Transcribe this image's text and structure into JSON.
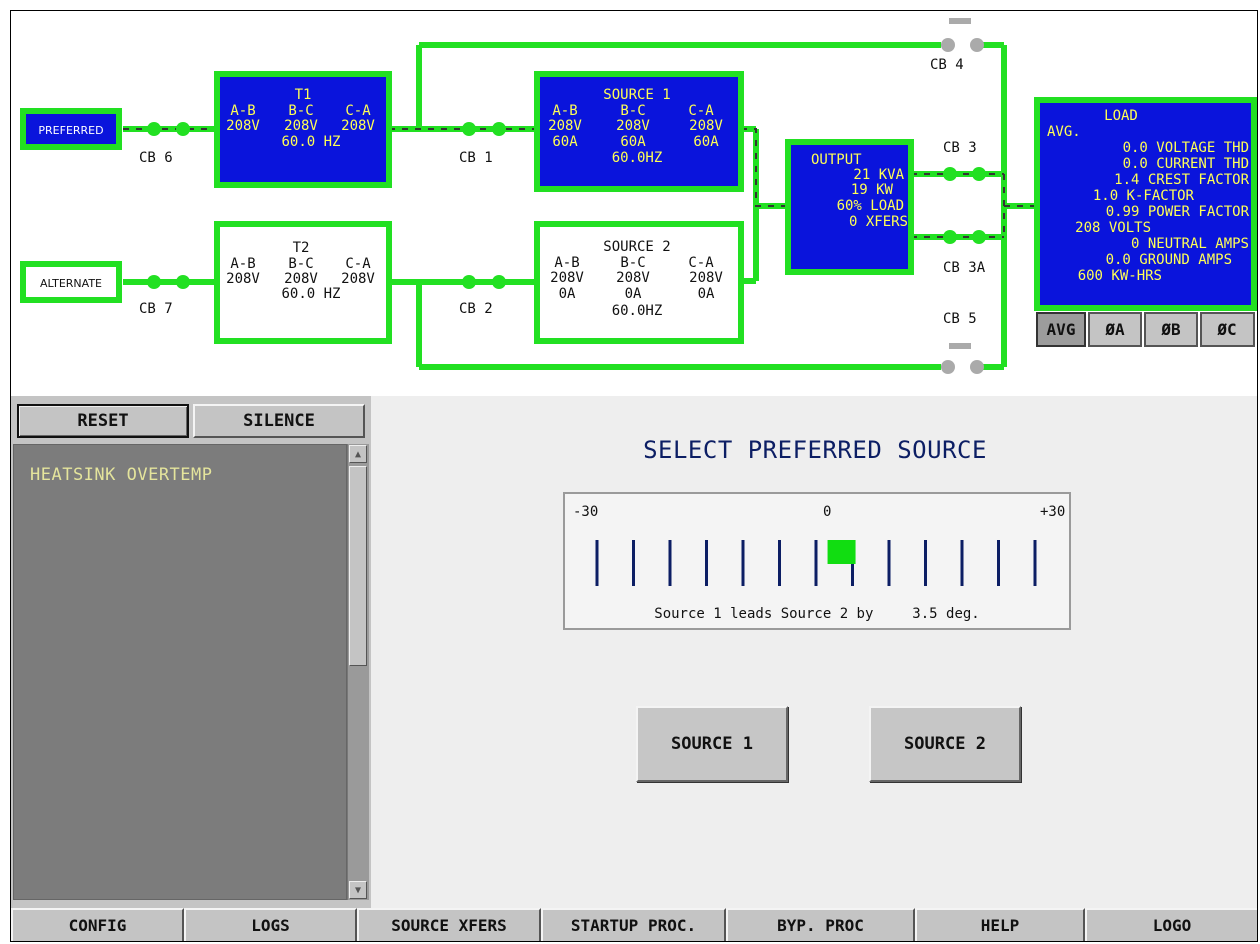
{
  "diagram": {
    "preferred_label": "PREFERRED",
    "alternate_label": "ALTERNATE",
    "breakers": {
      "cb6": "CB 6",
      "cb7": "CB 7",
      "cb1": "CB 1",
      "cb2": "CB 2",
      "cb3": "CB 3",
      "cb3a": "CB 3A",
      "cb4": "CB 4",
      "cb5": "CB 5"
    },
    "t1": {
      "title": "T1",
      "heads": [
        "A-B",
        "B-C",
        "C-A"
      ],
      "volts": [
        "208V",
        "208V",
        "208V"
      ],
      "freq": "60.0 HZ"
    },
    "t2": {
      "title": "T2",
      "heads": [
        "A-B",
        "B-C",
        "C-A"
      ],
      "volts": [
        "208V",
        "208V",
        "208V"
      ],
      "freq": "60.0 HZ"
    },
    "source1": {
      "title": "SOURCE 1",
      "heads": [
        "A-B",
        "B-C",
        "C-A"
      ],
      "volts": [
        "208V",
        "208V",
        "208V"
      ],
      "amps": [
        "60A",
        "60A",
        "60A"
      ],
      "freq": "60.0HZ"
    },
    "source2": {
      "title": "SOURCE 2",
      "heads": [
        "A-B",
        "B-C",
        "C-A"
      ],
      "volts": [
        "208V",
        "208V",
        "208V"
      ],
      "amps": [
        "0A",
        "0A",
        "0A"
      ],
      "freq": "60.0HZ"
    },
    "output": {
      "title": "OUTPUT",
      "lines": [
        "21 KVA",
        "19 KW",
        "60% LOAD",
        "0 XFERS"
      ]
    },
    "load": {
      "title": "LOAD",
      "subtitle": "AVG.",
      "lines": [
        "0.0 VOLTAGE THD",
        "0.0 CURRENT THD",
        "1.4 CREST FACTOR",
        "1.0 K-FACTOR",
        "0.99 POWER FACTOR",
        "208 VOLTS",
        "0 NEUTRAL AMPS",
        "0.0 GROUND AMPS",
        "600 KW-HRS"
      ]
    },
    "load_tabs": [
      "AVG",
      "ØA",
      "ØB",
      "ØC"
    ]
  },
  "alarms": {
    "reset_label": "RESET",
    "silence_label": "SILENCE",
    "messages": [
      "HEATSINK OVERTEMP"
    ]
  },
  "source_select": {
    "title": "SELECT PREFERRED SOURCE",
    "scale": {
      "min_label": "-30",
      "mid_label": "0",
      "max_label": "+30",
      "min": -30,
      "max": 30,
      "ticks": 13
    },
    "phase_deg": 3.5,
    "caption_prefix": "Source 1 leads Source 2 by",
    "caption_value": "3.5 deg.",
    "source1_button": "SOURCE 1",
    "source2_button": "SOURCE 2"
  },
  "footer": {
    "buttons": [
      "CONFIG",
      "LOGS",
      "SOURCE XFERS",
      "STARTUP PROC.",
      "BYP. PROC",
      "HELP",
      "LOGO"
    ]
  },
  "colors": {
    "bus_green": "#22e022",
    "panel_blue": "#0a14dc",
    "panel_text": "#ffff55",
    "indicator_green": "#11dd11"
  }
}
